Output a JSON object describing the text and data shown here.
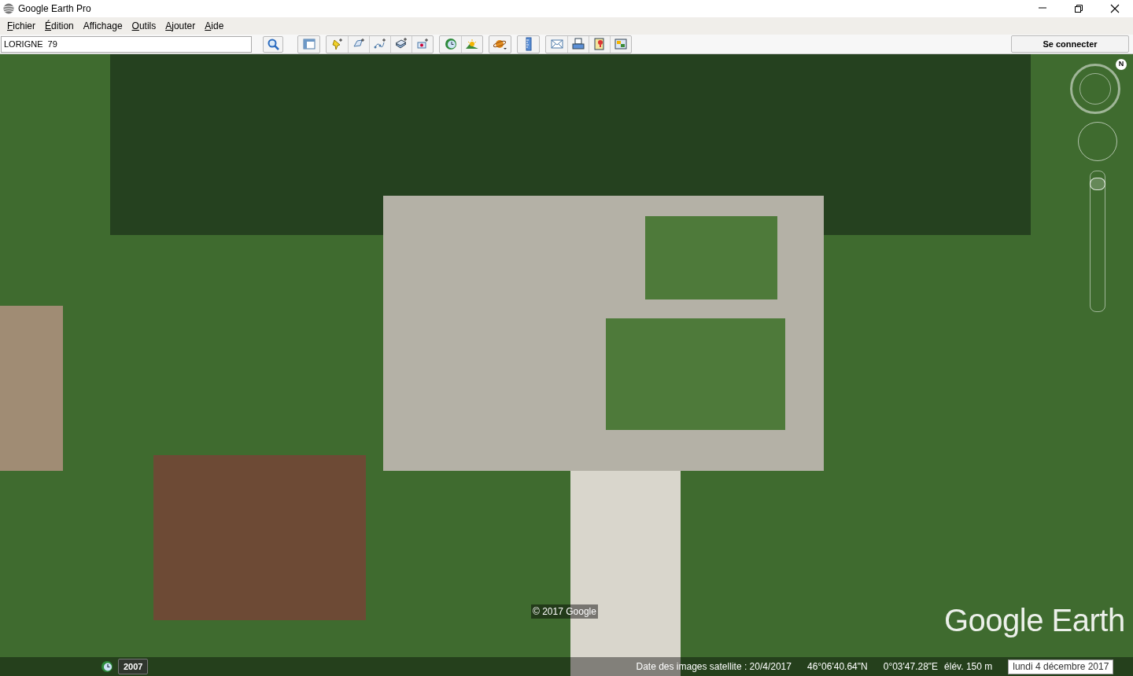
{
  "window": {
    "title": "Google Earth Pro"
  },
  "menu": [
    {
      "label": "Fichier",
      "underlined_initial": true
    },
    {
      "label": "Édition",
      "underlined_initial": true
    },
    {
      "label": "Affichage",
      "underlined_initial": false
    },
    {
      "label": "Outils",
      "underlined_initial": true
    },
    {
      "label": "Ajouter",
      "underlined_initial": true
    },
    {
      "label": "Aide",
      "underlined_initial": true
    }
  ],
  "search": {
    "value": "LORIGNE  79"
  },
  "zoom": {
    "level": 0.95
  },
  "sign_in": {
    "label": "Se connecter"
  },
  "map": {
    "copyright": "© 2017 Google",
    "logo": "Google Earth",
    "compass": "N",
    "time_badge": "2007"
  },
  "status_bar": {
    "imagery_date": "Date des images satellite : 20/4/2017",
    "lat": "46°06'40.64\"N",
    "lon": "0°03'47.28\"E",
    "elevation": "élév.  150 m",
    "today": "lundi 4 décembre 2017"
  }
}
